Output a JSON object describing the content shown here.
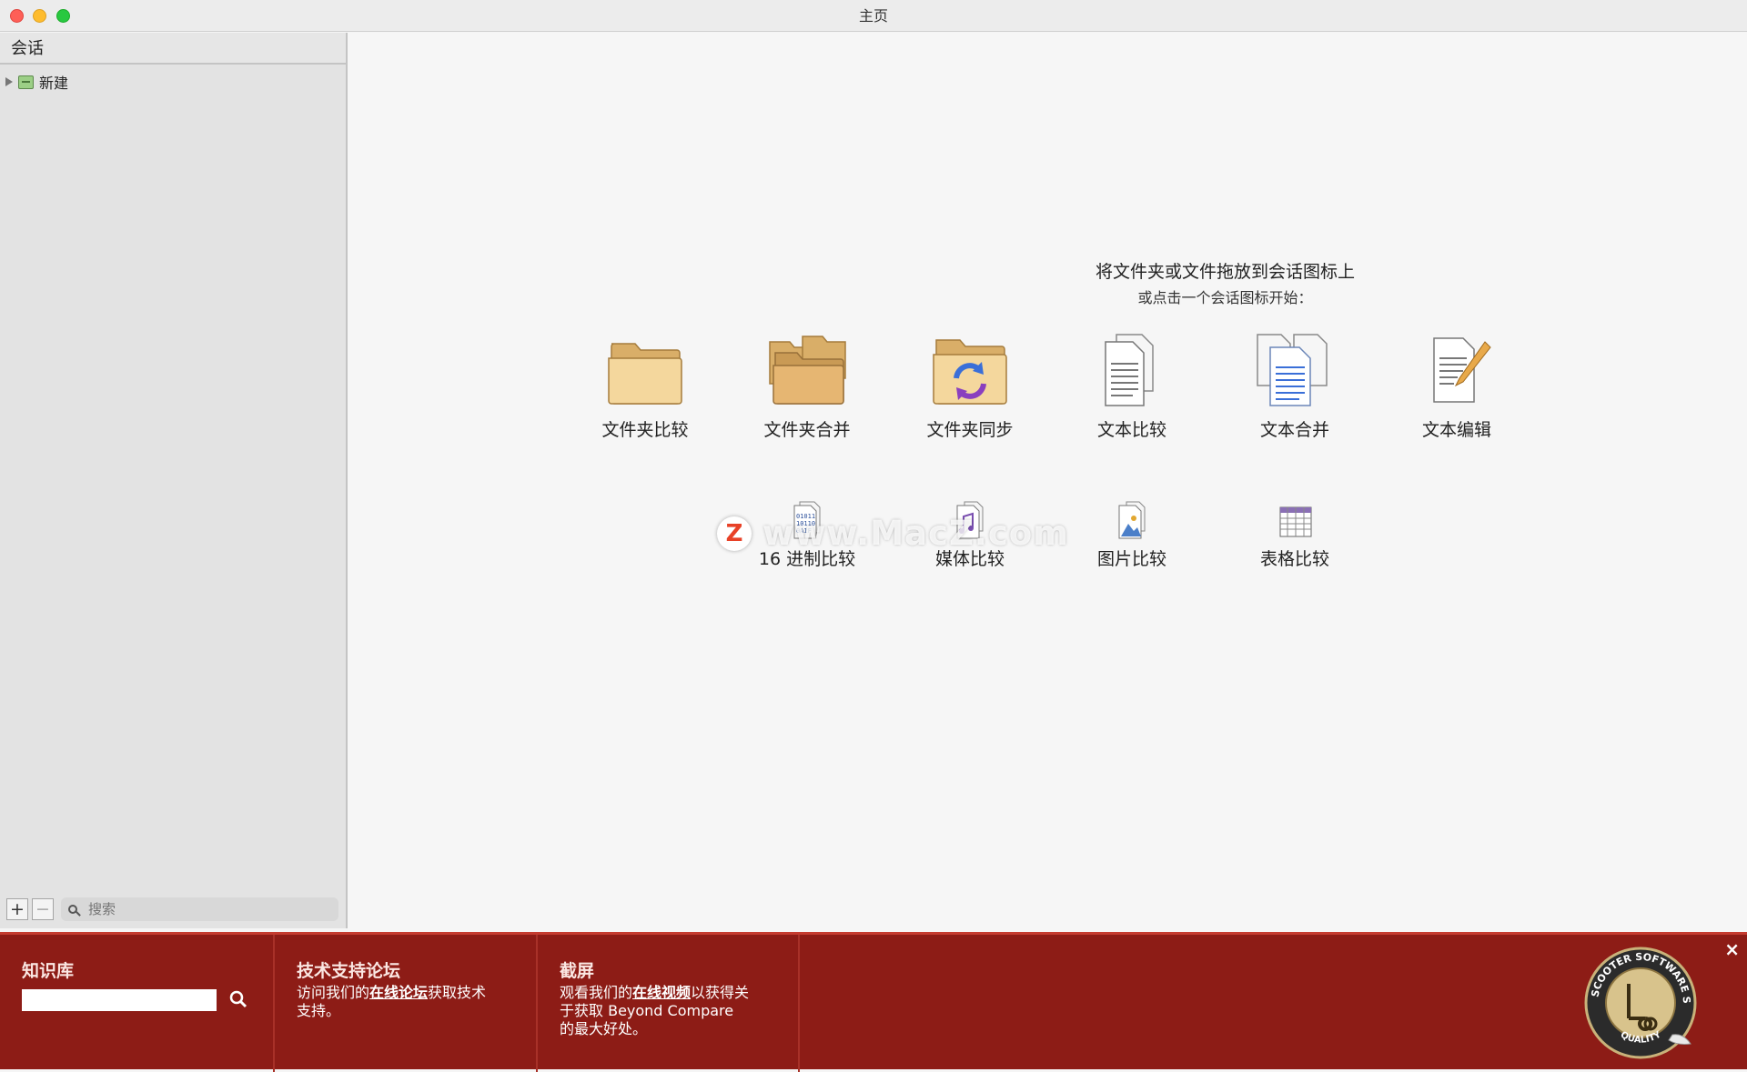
{
  "window": {
    "title": "主页"
  },
  "sidebar": {
    "header": "会话",
    "tree": [
      {
        "label": "新建",
        "icon": "session-folder-icon"
      }
    ],
    "add_label": "+",
    "remove_label": "−",
    "search_placeholder": "搜索"
  },
  "main": {
    "instruction_line1": "将文件夹或文件拖放到会话图标上",
    "instruction_line2": "或点击一个会话图标开始：",
    "sessions_row1": [
      {
        "label": "文件夹比较",
        "icon": "folder-compare-icon"
      },
      {
        "label": "文件夹合并",
        "icon": "folder-merge-icon"
      },
      {
        "label": "文件夹同步",
        "icon": "folder-sync-icon"
      },
      {
        "label": "文本比较",
        "icon": "text-compare-icon"
      },
      {
        "label": "文本合并",
        "icon": "text-merge-icon"
      },
      {
        "label": "文本编辑",
        "icon": "text-edit-icon"
      }
    ],
    "sessions_row2": [
      {
        "label": "16 进制比较",
        "icon": "hex-compare-icon"
      },
      {
        "label": "媒体比较",
        "icon": "media-compare-icon"
      },
      {
        "label": "图片比较",
        "icon": "picture-compare-icon"
      },
      {
        "label": "表格比较",
        "icon": "table-compare-icon"
      }
    ],
    "watermark": "www.MacZ.com",
    "watermark_badge": "Z"
  },
  "bottom_panel": {
    "knowledge_base": {
      "title": "知识库",
      "search_value": ""
    },
    "forum": {
      "title": "技术支持论坛",
      "text_before": "访问我们的",
      "link": "在线论坛",
      "text_after": "获取技术",
      "text_line2": "支持。"
    },
    "screenshots": {
      "title": "截屏",
      "text_before": "观看我们的",
      "link": "在线视频",
      "text_after": "以获得关",
      "text_line2": "于获取 Beyond Compare",
      "text_line3": "的最大好处。"
    },
    "seal_text": "SCOOTER SOFTWARE SEAL",
    "seal_bottom_text": "QUALITY",
    "close_label": "×"
  },
  "colors": {
    "panel_red": "#8d1c16",
    "folder_tan": "#ecc47f",
    "sync_blue": "#3a6fd8",
    "sync_purple": "#8a3fbf"
  }
}
